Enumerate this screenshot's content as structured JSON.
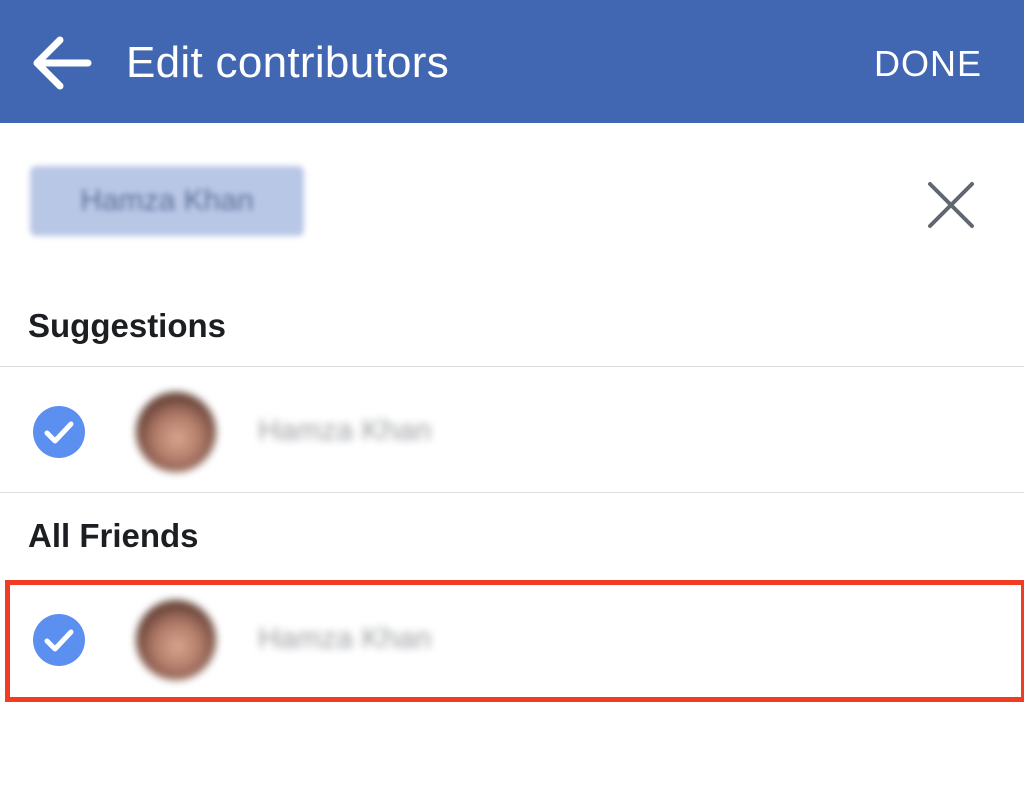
{
  "header": {
    "title": "Edit contributors",
    "done_label": "DONE",
    "back_icon": "arrow-left-icon"
  },
  "selected_chip": {
    "label": "Hamza Khan",
    "clear_icon": "close-icon"
  },
  "sections": {
    "suggestions": {
      "title": "Suggestions",
      "items": [
        {
          "name": "Hamza Khan",
          "selected": true
        }
      ]
    },
    "all_friends": {
      "title": "All Friends",
      "items": [
        {
          "name": "Hamza Khan",
          "selected": true
        }
      ]
    }
  },
  "colors": {
    "header_bg": "#4267b2",
    "check_blue": "#5b8ff0",
    "highlight_red": "#f03c23"
  }
}
